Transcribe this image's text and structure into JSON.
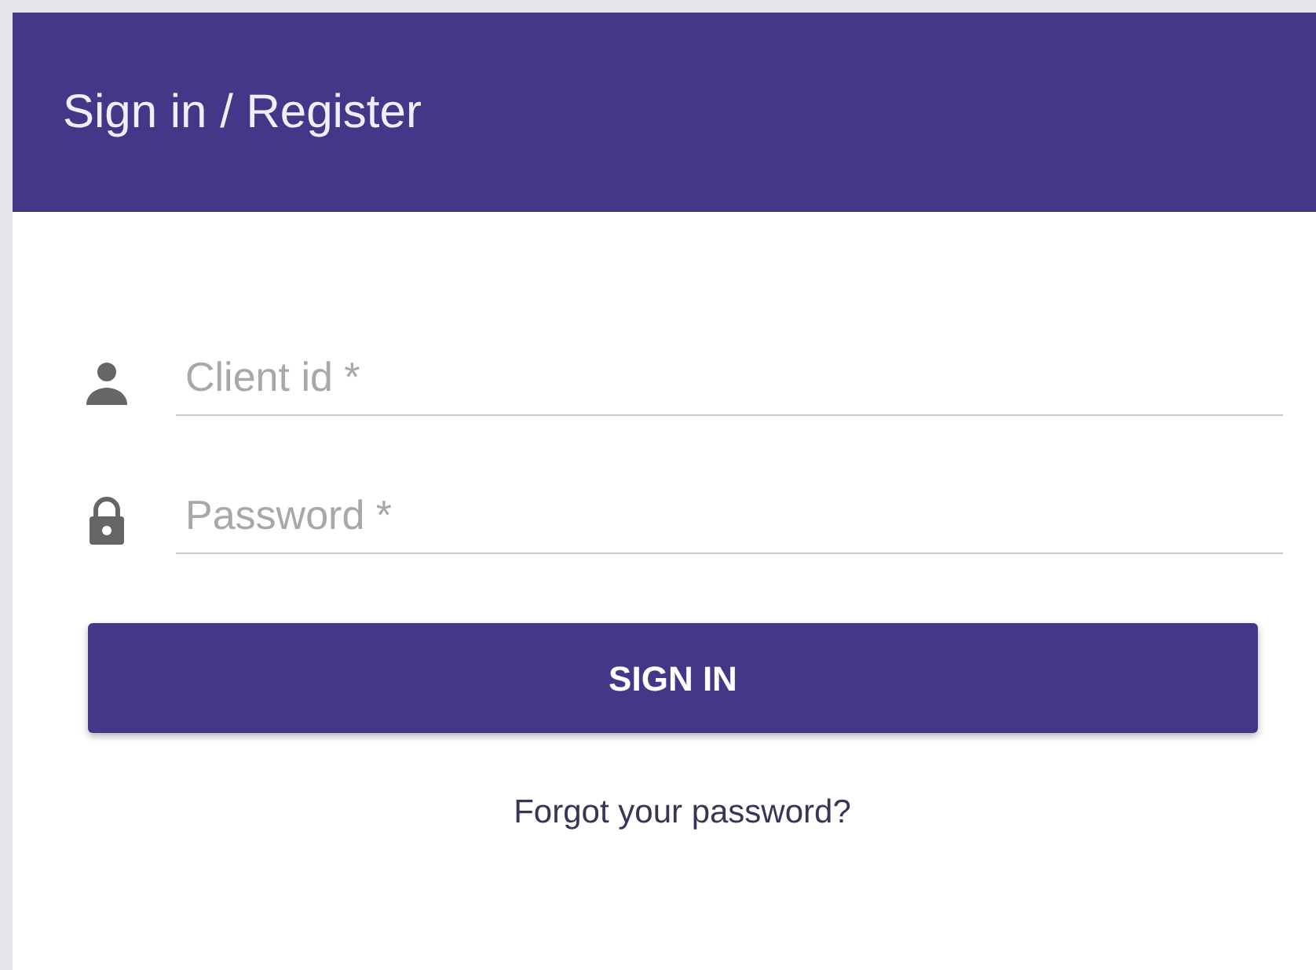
{
  "header": {
    "title": "Sign in / Register"
  },
  "fields": [
    {
      "kind": "text",
      "placeholder": "Client id *"
    },
    {
      "kind": "password",
      "placeholder": "Password *"
    }
  ],
  "submit_button": {
    "label": "SIGN IN"
  },
  "forgot_link": {
    "label": "Forgot your password?"
  }
}
